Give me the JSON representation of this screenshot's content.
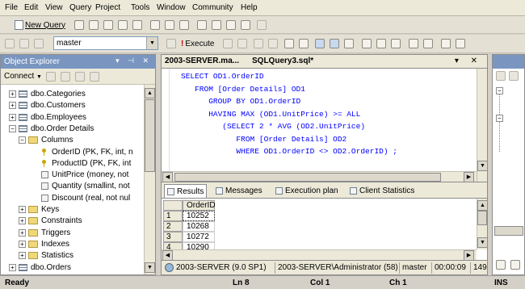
{
  "menubar": {
    "items": [
      "File",
      "Edit",
      "View",
      "Query",
      "Project",
      "Tools",
      "Window",
      "Community",
      "Help"
    ]
  },
  "toolbar": {
    "new_query_label": "New Query",
    "database_value": "master",
    "execute_label": "Execute"
  },
  "object_explorer": {
    "title": "Object Explorer",
    "connect_label": "Connect",
    "tree": [
      {
        "label": "dbo.Categories",
        "type": "table",
        "expander": "+"
      },
      {
        "label": "dbo.Customers",
        "type": "table",
        "expander": "+"
      },
      {
        "label": "dbo.Employees",
        "type": "table",
        "expander": "+"
      },
      {
        "label": "dbo.Order Details",
        "type": "table",
        "expander": "−"
      },
      {
        "label": "Columns",
        "type": "folder",
        "expander": "−"
      },
      {
        "label": "OrderID (PK, FK, int, n",
        "type": "key"
      },
      {
        "label": "ProductID (PK, FK, int",
        "type": "key"
      },
      {
        "label": "UnitPrice (money, not",
        "type": "column"
      },
      {
        "label": "Quantity (smallint, not",
        "type": "column"
      },
      {
        "label": "Discount (real, not nul",
        "type": "column"
      },
      {
        "label": "Keys",
        "type": "folder",
        "expander": "+"
      },
      {
        "label": "Constraints",
        "type": "folder",
        "expander": "+"
      },
      {
        "label": "Triggers",
        "type": "folder",
        "expander": "+"
      },
      {
        "label": "Indexes",
        "type": "folder",
        "expander": "+"
      },
      {
        "label": "Statistics",
        "type": "folder",
        "expander": "+"
      },
      {
        "label": "dbo.Orders",
        "type": "table",
        "expander": "+"
      }
    ]
  },
  "editor": {
    "tab_inactive": "2003-SERVER.ma...",
    "tab_active": "SQLQuery3.sql*",
    "code_lines": [
      "SELECT OD1.OrderID",
      "   FROM [Order Details] OD1",
      "      GROUP BY OD1.OrderID",
      "      HAVING MAX (OD1.UnitPrice) >= ALL",
      "         (SELECT 2 * AVG (OD2.UnitPrice)",
      "            FROM [Order Details] OD2",
      "            WHERE OD1.OrderID <> OD2.OrderID) ;"
    ]
  },
  "results": {
    "tabs": [
      "Results",
      "Messages",
      "Execution plan",
      "Client Statistics"
    ],
    "column_header": "OrderID",
    "rows": [
      {
        "num": "1",
        "value": "10252"
      },
      {
        "num": "2",
        "value": "10268"
      },
      {
        "num": "3",
        "value": "10272"
      },
      {
        "num": "4",
        "value": "10290"
      }
    ]
  },
  "query_status": {
    "server": "2003-SERVER (9.0 SP1)",
    "user": "2003-SERVER\\Administrator (58)",
    "database": "master",
    "elapsed": "00:00:09",
    "rows": "149"
  },
  "status_bar": {
    "state": "Ready",
    "line": "Ln 8",
    "col": "Col 1",
    "ch": "Ch 1",
    "mode": "INS"
  },
  "colors": {
    "panel_title": "#7a96c0",
    "keyword_blue": "#0000ff",
    "chrome": "#d4d0c8"
  }
}
